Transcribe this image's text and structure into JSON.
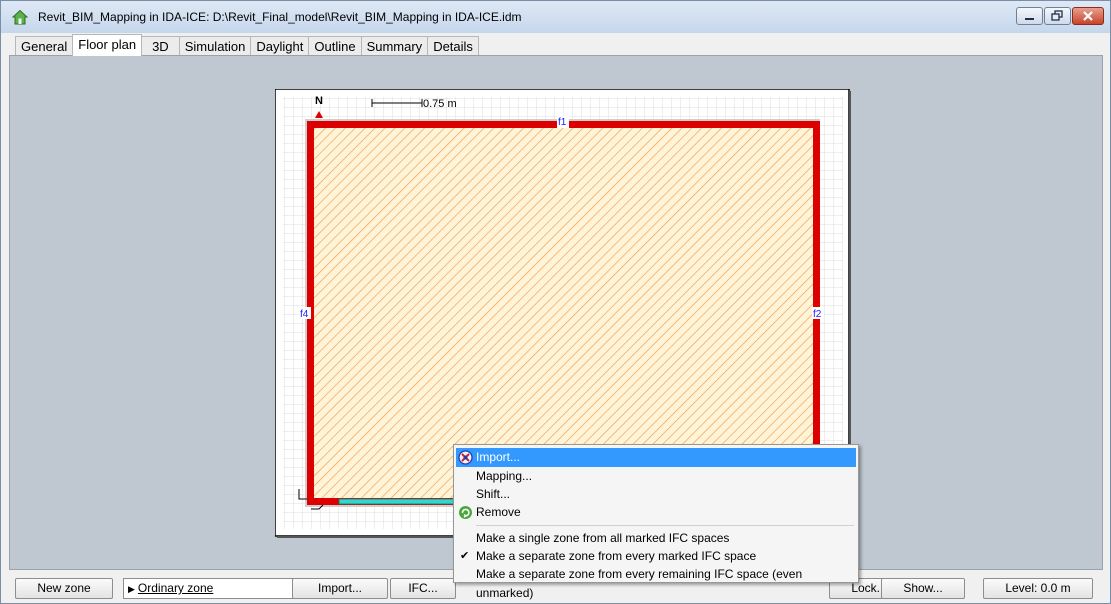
{
  "window": {
    "title": "Revit_BIM_Mapping in IDA-ICE: D:\\Revit_Final_model\\Revit_BIM_Mapping in IDA-ICE.idm"
  },
  "tabs": [
    "General",
    "Floor plan",
    "3D",
    "Simulation",
    "Daylight",
    "Outline",
    "Summary",
    "Details"
  ],
  "active_tab": "Floor plan",
  "plan": {
    "north_label": "N",
    "scale_label": "0.75 m",
    "walls": {
      "top": "f1",
      "right": "f2",
      "left": "f4"
    },
    "colors": {
      "wall": "#dd0000",
      "hatch": "#f29b4a",
      "floor": "#fff4d8",
      "window": "#33d6c8"
    }
  },
  "context_menu": {
    "items": [
      {
        "label": "Import...",
        "icon": "ifc-import-icon",
        "selected": true
      },
      {
        "label": "Mapping..."
      },
      {
        "label": "Shift..."
      },
      {
        "label": "Remove",
        "icon": "recycle-icon"
      }
    ],
    "options": [
      {
        "label": "Make a single zone from all marked IFC spaces",
        "checked": false
      },
      {
        "label": "Make a separate zone from every marked IFC space",
        "checked": true
      },
      {
        "label": "Make a separate zone from every remaining IFC space (even unmarked)",
        "checked": false
      }
    ]
  },
  "statusbar": {
    "new_zone": "New zone",
    "zone_type": "Ordinary zone",
    "import": "Import...",
    "ifc": "IFC...",
    "lock": "Lock...",
    "show": "Show...",
    "level": "Level: 0.0 m"
  }
}
